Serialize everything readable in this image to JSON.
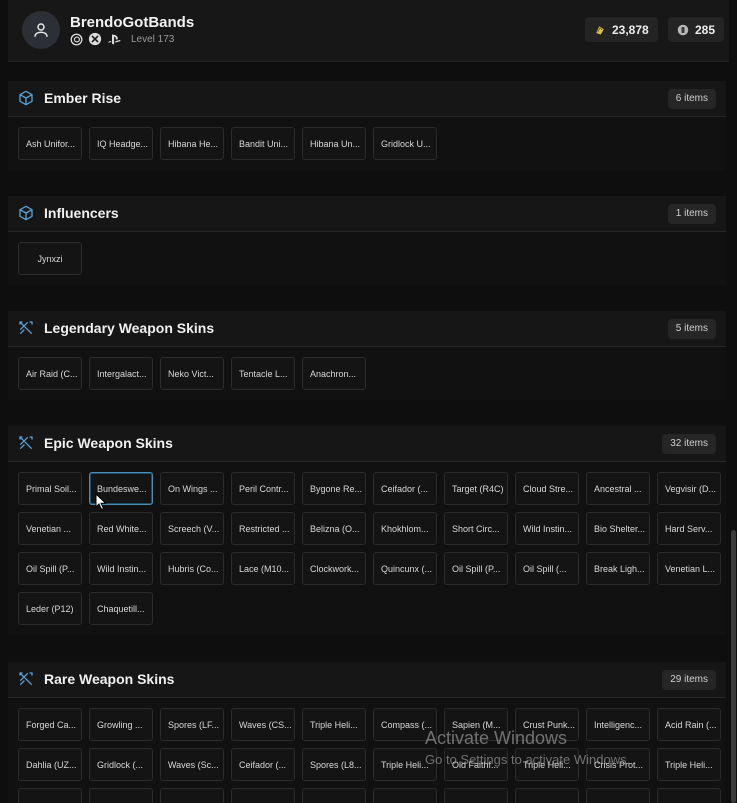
{
  "profile": {
    "username": "BrendoGotBands",
    "level": "Level 173"
  },
  "currency": {
    "credits": "23,878",
    "renown": "285"
  },
  "sections": [
    {
      "title": "Ember Rise",
      "count": "6 items",
      "icon": "box-icon",
      "items": [
        "Ash Unifor...",
        "IQ Headge...",
        "Hibana He...",
        "Bandit Uni...",
        "Hibana Un...",
        "Gridlock U..."
      ]
    },
    {
      "title": "Influencers",
      "count": "1 items",
      "icon": "box-icon",
      "items": [
        "Jynxzi"
      ]
    },
    {
      "title": "Legendary Weapon Skins",
      "count": "5 items",
      "icon": "crossed-swords-icon",
      "items": [
        "Air Raid (C...",
        "Intergalact...",
        "Neko Vict...",
        "Tentacle L...",
        "Anachron..."
      ]
    },
    {
      "title": "Epic Weapon Skins",
      "count": "32 items",
      "icon": "crossed-swords-icon",
      "items": [
        "Primal Soil...",
        "Bundeswe...",
        "On Wings ...",
        "Peril Contr...",
        "Bygone Re...",
        "Ceifador (...",
        "Target (R4C)",
        "Cloud Stre...",
        "Ancestral ...",
        "Vegvisir (D...",
        "Venetian ...",
        "Red White...",
        "Screech (V...",
        "Restricted ...",
        "Belizna (O...",
        "Khokhlom...",
        "Short Circ...",
        "Wild Instin...",
        "Bio Shelter...",
        "Hard Serv...",
        "Oil Spill (P...",
        "Wild Instin...",
        "Hubris (Co...",
        "Lace (M10...",
        "Clockwork...",
        "Quincunx (...",
        "Oil Spill (P...",
        "Oil Spill (...",
        "Break Ligh...",
        "Venetian L...",
        "Leder (P12)",
        "Chaquetill..."
      ]
    },
    {
      "title": "Rare Weapon Skins",
      "count": "29 items",
      "icon": "crossed-swords-icon",
      "items": [
        "Forged Ca...",
        "Growling ...",
        "Spores (LF...",
        "Waves (CS...",
        "Triple Heli...",
        "Compass (...",
        "Sapien (M...",
        "Crust Punk...",
        "Intelligenc...",
        "Acid Rain (...",
        "Dahlia (UZ...",
        "Gridlock (...",
        "Waves (Sc...",
        "Ceifador (...",
        "Spores (L8...",
        "Triple Heli...",
        "Old Faithf...",
        "Triple Heli...",
        "Crisis Prot...",
        "Triple Heli...",
        "",
        "",
        "",
        "",
        "",
        "",
        "",
        "",
        "",
        ""
      ]
    }
  ],
  "watermark": {
    "line1": "Activate Windows",
    "line2": "Go to Settings to activate Windows."
  },
  "colors": {
    "accent": "#5aa0d8",
    "selected_border": "#4a8fb3",
    "background": "#0e0e0e"
  }
}
